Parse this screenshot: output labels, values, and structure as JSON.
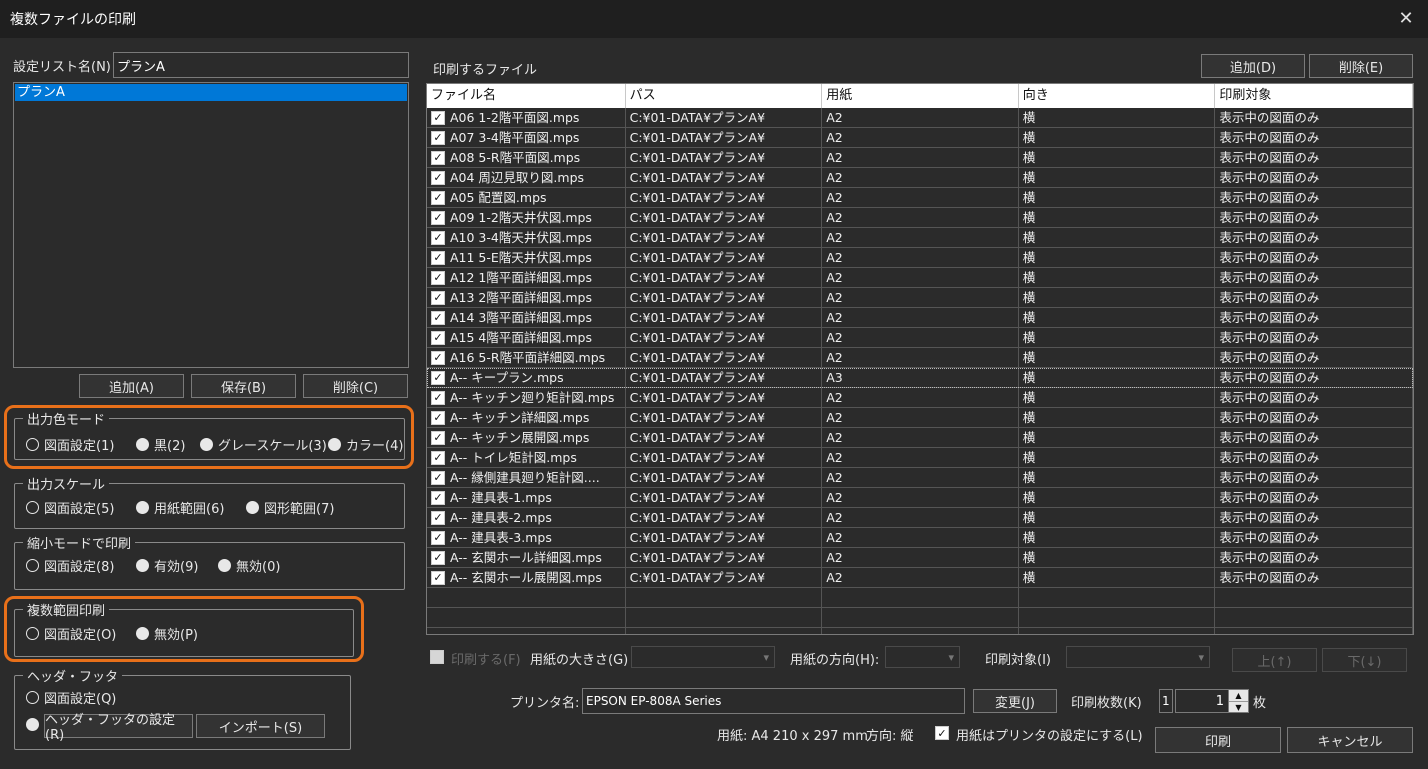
{
  "window": {
    "title": "複数ファイルの印刷"
  },
  "settings_list": {
    "label": "設定リスト名(N)",
    "name_value": "プランA",
    "items": [
      "プランA"
    ],
    "add_label": "追加(A)",
    "save_label": "保存(B)",
    "delete_label": "削除(C)"
  },
  "color_mode": {
    "legend": "出力色モード",
    "options": [
      "図面設定(1)",
      "黒(2)",
      "グレースケール(3)",
      "カラー(4)"
    ],
    "selected": 0
  },
  "output_scale": {
    "legend": "出力スケール",
    "options": [
      "図面設定(5)",
      "用紙範囲(6)",
      "図形範囲(7)"
    ],
    "selected": 0
  },
  "shrink_mode": {
    "legend": "縮小モードで印刷",
    "options": [
      "図面設定(8)",
      "有効(9)",
      "無効(0)"
    ],
    "selected": 0
  },
  "multi_range": {
    "legend": "複数範囲印刷",
    "options": [
      "図面設定(O)",
      "無効(P)"
    ],
    "selected": 0
  },
  "header_footer": {
    "legend": "ヘッダ・フッタ",
    "option_drawing": "図面設定(Q)",
    "settings_button": "ヘッダ・フッタの設定(R)",
    "import_button": "インポート(S)"
  },
  "files": {
    "label": "印刷するファイル",
    "add_label": "追加(D)",
    "delete_label": "削除(E)",
    "columns": [
      "ファイル名",
      "パス",
      "用紙",
      "向き",
      "印刷対象"
    ],
    "rows": [
      {
        "name": "A06 1-2階平面図.mps",
        "path": "C:¥01-DATA¥プランA¥",
        "paper": "A2",
        "orient": "横",
        "target": "表示中の図面のみ"
      },
      {
        "name": "A07 3-4階平面図.mps",
        "path": "C:¥01-DATA¥プランA¥",
        "paper": "A2",
        "orient": "横",
        "target": "表示中の図面のみ"
      },
      {
        "name": "A08 5-R階平面図.mps",
        "path": "C:¥01-DATA¥プランA¥",
        "paper": "A2",
        "orient": "横",
        "target": "表示中の図面のみ"
      },
      {
        "name": "A04 周辺見取り図.mps",
        "path": "C:¥01-DATA¥プランA¥",
        "paper": "A2",
        "orient": "横",
        "target": "表示中の図面のみ"
      },
      {
        "name": "A05 配置図.mps",
        "path": "C:¥01-DATA¥プランA¥",
        "paper": "A2",
        "orient": "横",
        "target": "表示中の図面のみ"
      },
      {
        "name": "A09 1-2階天井伏図.mps",
        "path": "C:¥01-DATA¥プランA¥",
        "paper": "A2",
        "orient": "横",
        "target": "表示中の図面のみ"
      },
      {
        "name": "A10 3-4階天井伏図.mps",
        "path": "C:¥01-DATA¥プランA¥",
        "paper": "A2",
        "orient": "横",
        "target": "表示中の図面のみ"
      },
      {
        "name": "A11 5-E階天井伏図.mps",
        "path": "C:¥01-DATA¥プランA¥",
        "paper": "A2",
        "orient": "横",
        "target": "表示中の図面のみ"
      },
      {
        "name": "A12 1階平面詳細図.mps",
        "path": "C:¥01-DATA¥プランA¥",
        "paper": "A2",
        "orient": "横",
        "target": "表示中の図面のみ"
      },
      {
        "name": "A13 2階平面詳細図.mps",
        "path": "C:¥01-DATA¥プランA¥",
        "paper": "A2",
        "orient": "横",
        "target": "表示中の図面のみ"
      },
      {
        "name": "A14 3階平面詳細図.mps",
        "path": "C:¥01-DATA¥プランA¥",
        "paper": "A2",
        "orient": "横",
        "target": "表示中の図面のみ"
      },
      {
        "name": "A15 4階平面詳細図.mps",
        "path": "C:¥01-DATA¥プランA¥",
        "paper": "A2",
        "orient": "横",
        "target": "表示中の図面のみ"
      },
      {
        "name": "A16 5-R階平面詳細図.mps",
        "path": "C:¥01-DATA¥プランA¥",
        "paper": "A2",
        "orient": "横",
        "target": "表示中の図面のみ"
      },
      {
        "name": "A-- キープラン.mps",
        "path": "C:¥01-DATA¥プランA¥",
        "paper": "A3",
        "orient": "横",
        "target": "表示中の図面のみ"
      },
      {
        "name": "A-- キッチン廻り矩計図.mps",
        "path": "C:¥01-DATA¥プランA¥",
        "paper": "A2",
        "orient": "横",
        "target": "表示中の図面のみ"
      },
      {
        "name": "A-- キッチン詳細図.mps",
        "path": "C:¥01-DATA¥プランA¥",
        "paper": "A2",
        "orient": "横",
        "target": "表示中の図面のみ"
      },
      {
        "name": "A-- キッチン展開図.mps",
        "path": "C:¥01-DATA¥プランA¥",
        "paper": "A2",
        "orient": "横",
        "target": "表示中の図面のみ"
      },
      {
        "name": "A-- トイレ矩計図.mps",
        "path": "C:¥01-DATA¥プランA¥",
        "paper": "A2",
        "orient": "横",
        "target": "表示中の図面のみ"
      },
      {
        "name": "A-- 縁側建具廻り矩計図....",
        "path": "C:¥01-DATA¥プランA¥",
        "paper": "A2",
        "orient": "横",
        "target": "表示中の図面のみ"
      },
      {
        "name": "A-- 建具表-1.mps",
        "path": "C:¥01-DATA¥プランA¥",
        "paper": "A2",
        "orient": "横",
        "target": "表示中の図面のみ"
      },
      {
        "name": "A-- 建具表-2.mps",
        "path": "C:¥01-DATA¥プランA¥",
        "paper": "A2",
        "orient": "横",
        "target": "表示中の図面のみ"
      },
      {
        "name": "A-- 建具表-3.mps",
        "path": "C:¥01-DATA¥プランA¥",
        "paper": "A2",
        "orient": "横",
        "target": "表示中の図面のみ"
      },
      {
        "name": "A-- 玄関ホール詳細図.mps",
        "path": "C:¥01-DATA¥プランA¥",
        "paper": "A2",
        "orient": "横",
        "target": "表示中の図面のみ"
      },
      {
        "name": "A-- 玄関ホール展開図.mps",
        "path": "C:¥01-DATA¥プランA¥",
        "paper": "A2",
        "orient": "横",
        "target": "表示中の図面のみ"
      }
    ],
    "focused_row": 13,
    "empty_rows": 3
  },
  "row_options": {
    "print_label": "印刷する(F)",
    "paper_size_label": "用紙の大きさ(G)",
    "orientation_label": "用紙の方向(H):",
    "target_label": "印刷対象(I)",
    "up_label": "上(↑)",
    "down_label": "下(↓)"
  },
  "printer": {
    "label": "プリンタ名:",
    "name": "EPSON EP-808A Series",
    "change_label": "変更(J)",
    "copies_label": "印刷枚数(K)",
    "copies_small": "1",
    "copies_value": "1",
    "copies_unit": "枚",
    "paper_info": "用紙: A4 210 x 297 mm",
    "orient_info": "方向: 縦",
    "use_printer_paper_label": "用紙はプリンタの設定にする(L)"
  },
  "actions": {
    "print_label": "印刷",
    "cancel_label": "キャンセル"
  }
}
